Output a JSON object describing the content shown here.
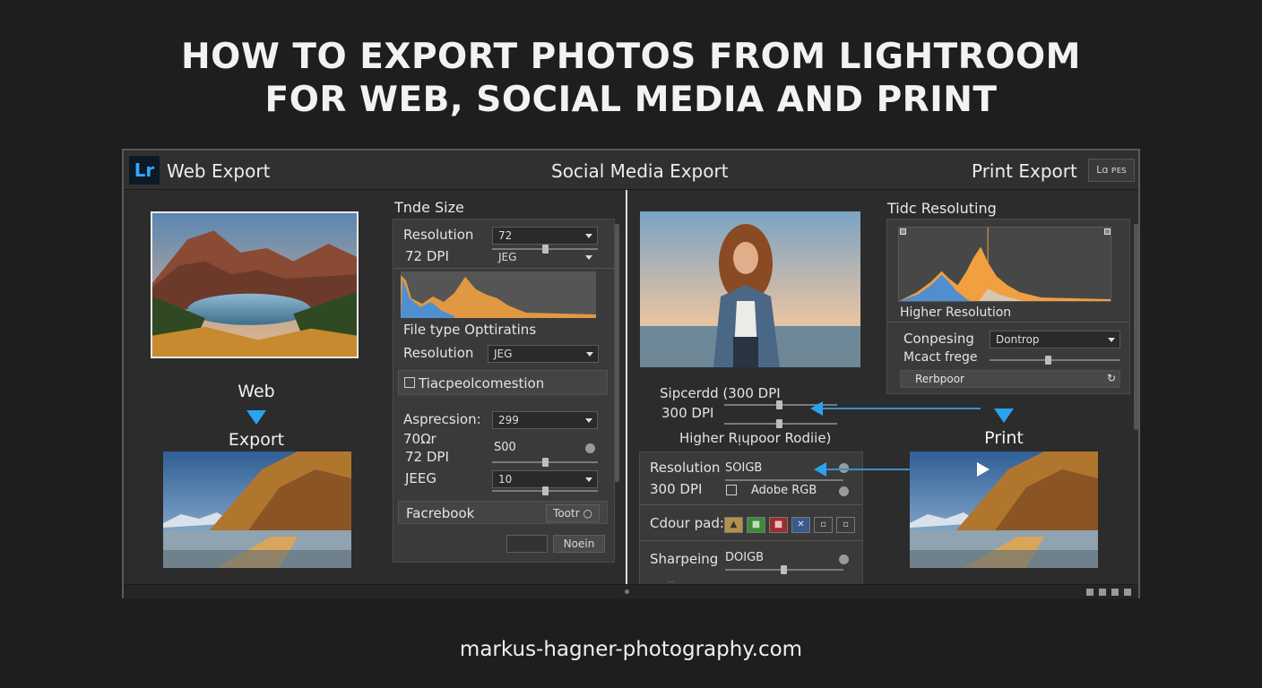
{
  "headline": {
    "line1": "HOW TO EXPORT PHOTOS FROM LIGHTROOM",
    "line2": "FOR WEB, SOCIAL MEDIA AND PRINT"
  },
  "footer": {
    "url": "markus-hagner-photography.com"
  },
  "window": {
    "logo": "Lr",
    "tab_web": "Web Export",
    "tab_social": "Social Media Export",
    "tab_print": "Print Export",
    "top_right_button": "Lɑ ᴘᴇs"
  },
  "left": {
    "label_web": "Web",
    "label_export": "Export"
  },
  "web_panel": {
    "title": "Tnde Size",
    "resolution_label": "Resolution",
    "resolution_value": "72",
    "dpi_label": "72 DPI",
    "format_value": "JEG",
    "filetype_label": "File type Opttiratins",
    "resolution2_label": "Resolution",
    "resolution2_value": "JEG",
    "checkbox_label": "Tiacpeolcomestion",
    "aspect_label": "Asprecsion:",
    "aspect_value": "299",
    "size_label": "70Ωr",
    "size_value": "S00",
    "dpi2_label": "72 DPI",
    "jpeg_label": "JEEG",
    "quality_value": "10",
    "facebook_label": "Facrebook",
    "facebook_button": "Tootr ○",
    "bottom_button": "Noein"
  },
  "social_area": {
    "speed_label": "Sipcerdd  (300 DPI",
    "dpi_label": "300 DPI",
    "higher_label": "Higher Rᴉɥpoor Rodiie)"
  },
  "social_panel": {
    "resolution_label": "Resolution",
    "resolution_value": "SOIGB",
    "dpi_label": "300 DPI",
    "colorspace_value": "Adobe RGB",
    "colour_label": "Cdour pad:",
    "swatches": [
      "▲",
      "■",
      "■",
      "✕",
      "▫",
      "▫"
    ],
    "sharpening_label": "Sharpeing",
    "sharpening_value": "DOIGB",
    "faded_text": "..."
  },
  "print_panel": {
    "title": "Tidc Resoluting",
    "higher_label": "Higher Resolution",
    "compressing_label": "Conpesing",
    "compressing_value": "Dontrop",
    "mact_label": "Mcact frege",
    "refresh_label": "Rerbpoor",
    "refresh_icon": "↻"
  },
  "right": {
    "label_print": "Print"
  },
  "colors": {
    "background": "#1e1e1e",
    "window": "#2c2c2c",
    "panel": "#3a3a3a",
    "accent_blue": "#2aa3ee",
    "lr_blue": "#31a8ff",
    "histogram_orange": "#f0a040",
    "histogram_blue": "#4f8fd0"
  }
}
